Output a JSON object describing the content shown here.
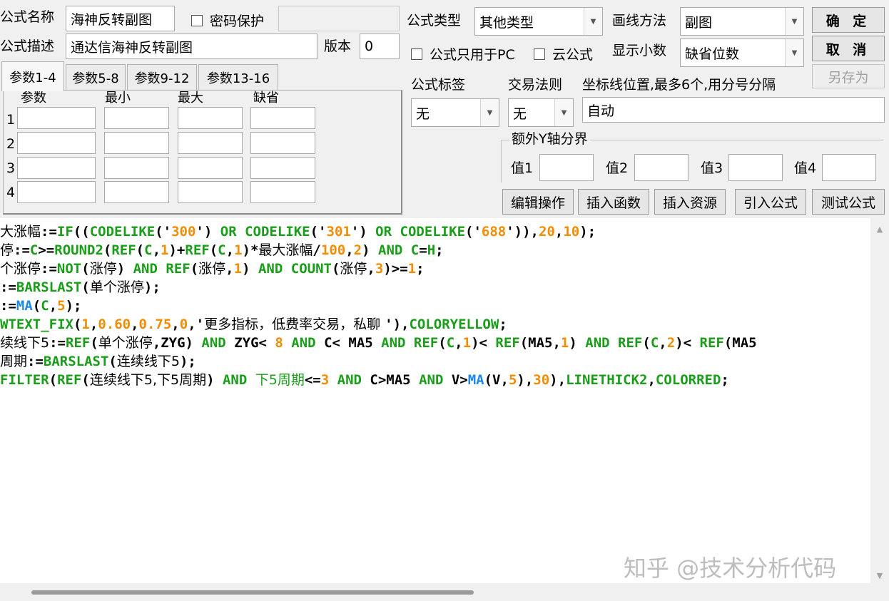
{
  "formula": {
    "name_label": "公式名称",
    "name_value": "海神反转副图",
    "password_label": "密码保护",
    "desc_label": "公式描述",
    "desc_value": "通达信海神反转副图",
    "version_label": "版本",
    "version_value": "0"
  },
  "options": {
    "type_label": "公式类型",
    "type_value": "其他类型",
    "draw_label": "画线方法",
    "draw_value": "副图",
    "pc_only_label": "公式只用于PC",
    "cloud_label": "云公式",
    "decimals_label": "显示小数",
    "decimals_value": "缺省位数",
    "tag_label": "公式标签",
    "tag_value": "无",
    "rule_label": "交易法则",
    "rule_value": "无",
    "axis_label": "坐标线位置,最多6个,用分号分隔",
    "axis_value": "自动",
    "extra_y_label": "额外Y轴分界",
    "values": [
      "值1",
      "值2",
      "值3",
      "值4"
    ]
  },
  "buttons": {
    "ok": "确 定",
    "cancel": "取 消",
    "save_as": "另存为",
    "edit_ops": "编辑操作",
    "insert_func": "插入函数",
    "insert_res": "插入资源",
    "import_formula": "引入公式",
    "test_formula": "测试公式"
  },
  "params": {
    "tabs": [
      "参数1-4",
      "参数5-8",
      "参数9-12",
      "参数13-16"
    ],
    "headers": [
      "参数",
      "最小",
      "最大",
      "缺省"
    ],
    "rows": [
      "1",
      "2",
      "3",
      "4"
    ]
  },
  "code_lines": [
    [
      [
        "t",
        "大涨幅"
      ],
      [
        "d",
        ":="
      ],
      [
        "g",
        "IF"
      ],
      [
        "d",
        "(("
      ],
      [
        "g",
        "CODELIKE"
      ],
      [
        "d",
        "('"
      ],
      [
        "n",
        "300"
      ],
      [
        "d",
        "') "
      ],
      [
        "g",
        "OR"
      ],
      [
        "d",
        " "
      ],
      [
        "g",
        "CODELIKE"
      ],
      [
        "d",
        "('"
      ],
      [
        "n",
        "301"
      ],
      [
        "d",
        "') "
      ],
      [
        "g",
        "OR"
      ],
      [
        "d",
        " "
      ],
      [
        "g",
        "CODELIKE"
      ],
      [
        "d",
        "('"
      ],
      [
        "n",
        "688"
      ],
      [
        "d",
        "')),"
      ],
      [
        "n",
        "20"
      ],
      [
        "d",
        ","
      ],
      [
        "n",
        "10"
      ],
      [
        "d",
        ");"
      ]
    ],
    [
      [
        "t",
        "停"
      ],
      [
        "d",
        ":="
      ],
      [
        "g",
        "C"
      ],
      [
        "d",
        ">="
      ],
      [
        "g",
        "ROUND2"
      ],
      [
        "d",
        "("
      ],
      [
        "g",
        "REF"
      ],
      [
        "d",
        "("
      ],
      [
        "g",
        "C"
      ],
      [
        "d",
        ","
      ],
      [
        "n",
        "1"
      ],
      [
        "d",
        ")+"
      ],
      [
        "g",
        "REF"
      ],
      [
        "d",
        "("
      ],
      [
        "g",
        "C"
      ],
      [
        "d",
        ","
      ],
      [
        "n",
        "1"
      ],
      [
        "d",
        ")*"
      ],
      [
        "t",
        "最大涨幅"
      ],
      [
        "d",
        "/"
      ],
      [
        "n",
        "100"
      ],
      [
        "d",
        ","
      ],
      [
        "n",
        "2"
      ],
      [
        "d",
        ") "
      ],
      [
        "g",
        "AND"
      ],
      [
        "d",
        " "
      ],
      [
        "g",
        "C"
      ],
      [
        "d",
        "="
      ],
      [
        "g",
        "H"
      ],
      [
        "d",
        ";"
      ]
    ],
    [
      [
        "t",
        "个涨停"
      ],
      [
        "d",
        ":="
      ],
      [
        "g",
        "NOT"
      ],
      [
        "d",
        "("
      ],
      [
        "t",
        "涨停"
      ],
      [
        "d",
        ") "
      ],
      [
        "g",
        "AND"
      ],
      [
        "d",
        " "
      ],
      [
        "g",
        "REF"
      ],
      [
        "d",
        "("
      ],
      [
        "t",
        "涨停"
      ],
      [
        "d",
        ","
      ],
      [
        "n",
        "1"
      ],
      [
        "d",
        ") "
      ],
      [
        "g",
        "AND"
      ],
      [
        "d",
        " "
      ],
      [
        "g",
        "COUNT"
      ],
      [
        "d",
        "("
      ],
      [
        "t",
        "涨停"
      ],
      [
        "d",
        ","
      ],
      [
        "n",
        "3"
      ],
      [
        "d",
        ")>="
      ],
      [
        "n",
        "1"
      ],
      [
        "d",
        ";"
      ]
    ],
    [
      [
        "d",
        ":="
      ],
      [
        "g",
        "BARSLAST"
      ],
      [
        "d",
        "("
      ],
      [
        "t",
        "单个涨停"
      ],
      [
        "d",
        ");"
      ]
    ],
    [
      [
        "d",
        ":="
      ],
      [
        "b",
        "MA"
      ],
      [
        "d",
        "("
      ],
      [
        "g",
        "C"
      ],
      [
        "d",
        ","
      ],
      [
        "n",
        "5"
      ],
      [
        "d",
        ");"
      ]
    ],
    [
      [
        "g",
        "WTEXT_FIX"
      ],
      [
        "d",
        "("
      ],
      [
        "n",
        "1"
      ],
      [
        "d",
        ","
      ],
      [
        "n",
        "0.60"
      ],
      [
        "d",
        ","
      ],
      [
        "n",
        "0.75"
      ],
      [
        "d",
        ","
      ],
      [
        "n",
        "0"
      ],
      [
        "d",
        ",'"
      ],
      [
        "t",
        "更多指标，低费率交易，私聊 "
      ],
      [
        "d",
        "'),"
      ],
      [
        "g",
        "COLORYELLOW"
      ],
      [
        "d",
        ";"
      ]
    ],
    [
      [
        "t",
        "续线下5"
      ],
      [
        "d",
        ":="
      ],
      [
        "g",
        "REF"
      ],
      [
        "d",
        "("
      ],
      [
        "t",
        "单个涨停"
      ],
      [
        "d",
        ",ZYG) "
      ],
      [
        "g",
        "AND"
      ],
      [
        "d",
        " ZYG< "
      ],
      [
        "n",
        "8"
      ],
      [
        "d",
        " "
      ],
      [
        "g",
        "AND"
      ],
      [
        "d",
        " C< MA5 "
      ],
      [
        "g",
        "AND"
      ],
      [
        "d",
        " "
      ],
      [
        "g",
        "REF"
      ],
      [
        "d",
        "("
      ],
      [
        "g",
        "C"
      ],
      [
        "d",
        ","
      ],
      [
        "n",
        "1"
      ],
      [
        "d",
        ")< "
      ],
      [
        "g",
        "REF"
      ],
      [
        "d",
        "(MA5,"
      ],
      [
        "n",
        "1"
      ],
      [
        "d",
        ") "
      ],
      [
        "g",
        "AND"
      ],
      [
        "d",
        " "
      ],
      [
        "g",
        "REF"
      ],
      [
        "d",
        "("
      ],
      [
        "g",
        "C"
      ],
      [
        "d",
        ","
      ],
      [
        "n",
        "2"
      ],
      [
        "d",
        ")< "
      ],
      [
        "g",
        "REF"
      ],
      [
        "d",
        "(MA5"
      ]
    ],
    [
      [
        "t",
        "周期"
      ],
      [
        "d",
        ":="
      ],
      [
        "g",
        "BARSLAST"
      ],
      [
        "d",
        "("
      ],
      [
        "t",
        "连续线下5"
      ],
      [
        "d",
        ");"
      ]
    ],
    [
      [
        "g",
        "FILTER"
      ],
      [
        "d",
        "("
      ],
      [
        "g",
        "REF"
      ],
      [
        "d",
        "("
      ],
      [
        "t",
        "连续线下5,下5周期"
      ],
      [
        "d",
        ") "
      ],
      [
        "g",
        "AND"
      ],
      [
        "d",
        " "
      ],
      [
        "gt",
        "下5周期"
      ],
      [
        "d",
        "<="
      ],
      [
        "n",
        "3"
      ],
      [
        "d",
        " "
      ],
      [
        "g",
        "AND"
      ],
      [
        "d",
        " C>MA5 "
      ],
      [
        "g",
        "AND"
      ],
      [
        "d",
        " V>"
      ],
      [
        "b",
        "MA"
      ],
      [
        "d",
        "(V,"
      ],
      [
        "n",
        "5"
      ],
      [
        "d",
        "),"
      ],
      [
        "n",
        "30"
      ],
      [
        "d",
        "),"
      ],
      [
        "g",
        "LINETHICK2"
      ],
      [
        "d",
        ","
      ],
      [
        "g",
        "COLORRED"
      ],
      [
        "d",
        ";"
      ]
    ]
  ],
  "watermark": "知乎 @技术分析代码",
  "colors": {
    "keyword": "#1a9e1a",
    "number": "#f28c00",
    "func_blue": "#1e88e5"
  }
}
